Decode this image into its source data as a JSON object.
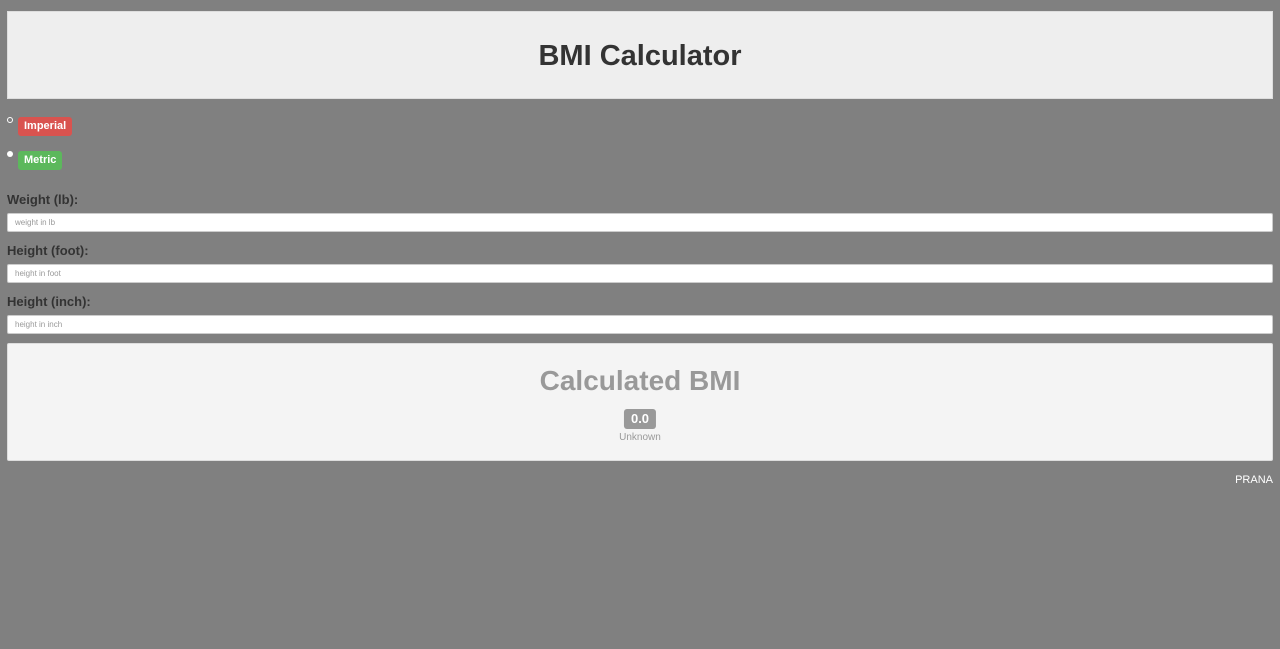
{
  "header": {
    "title": "BMI Calculator"
  },
  "units": {
    "imperial_label": "Imperial",
    "metric_label": "Metric",
    "selected": "Metric",
    "imperial_color": "#d9534f",
    "metric_color": "#5cb85c"
  },
  "form": {
    "weight": {
      "label": "Weight (lb):",
      "placeholder": "weight in lb",
      "value": ""
    },
    "height_foot": {
      "label": "Height (foot):",
      "placeholder": "height in foot",
      "value": ""
    },
    "height_inch": {
      "label": "Height (inch):",
      "placeholder": "height in inch",
      "value": ""
    }
  },
  "result": {
    "title": "Calculated BMI",
    "value": "0.0",
    "status": "Unknown"
  },
  "footer": {
    "text": "PRANA"
  }
}
